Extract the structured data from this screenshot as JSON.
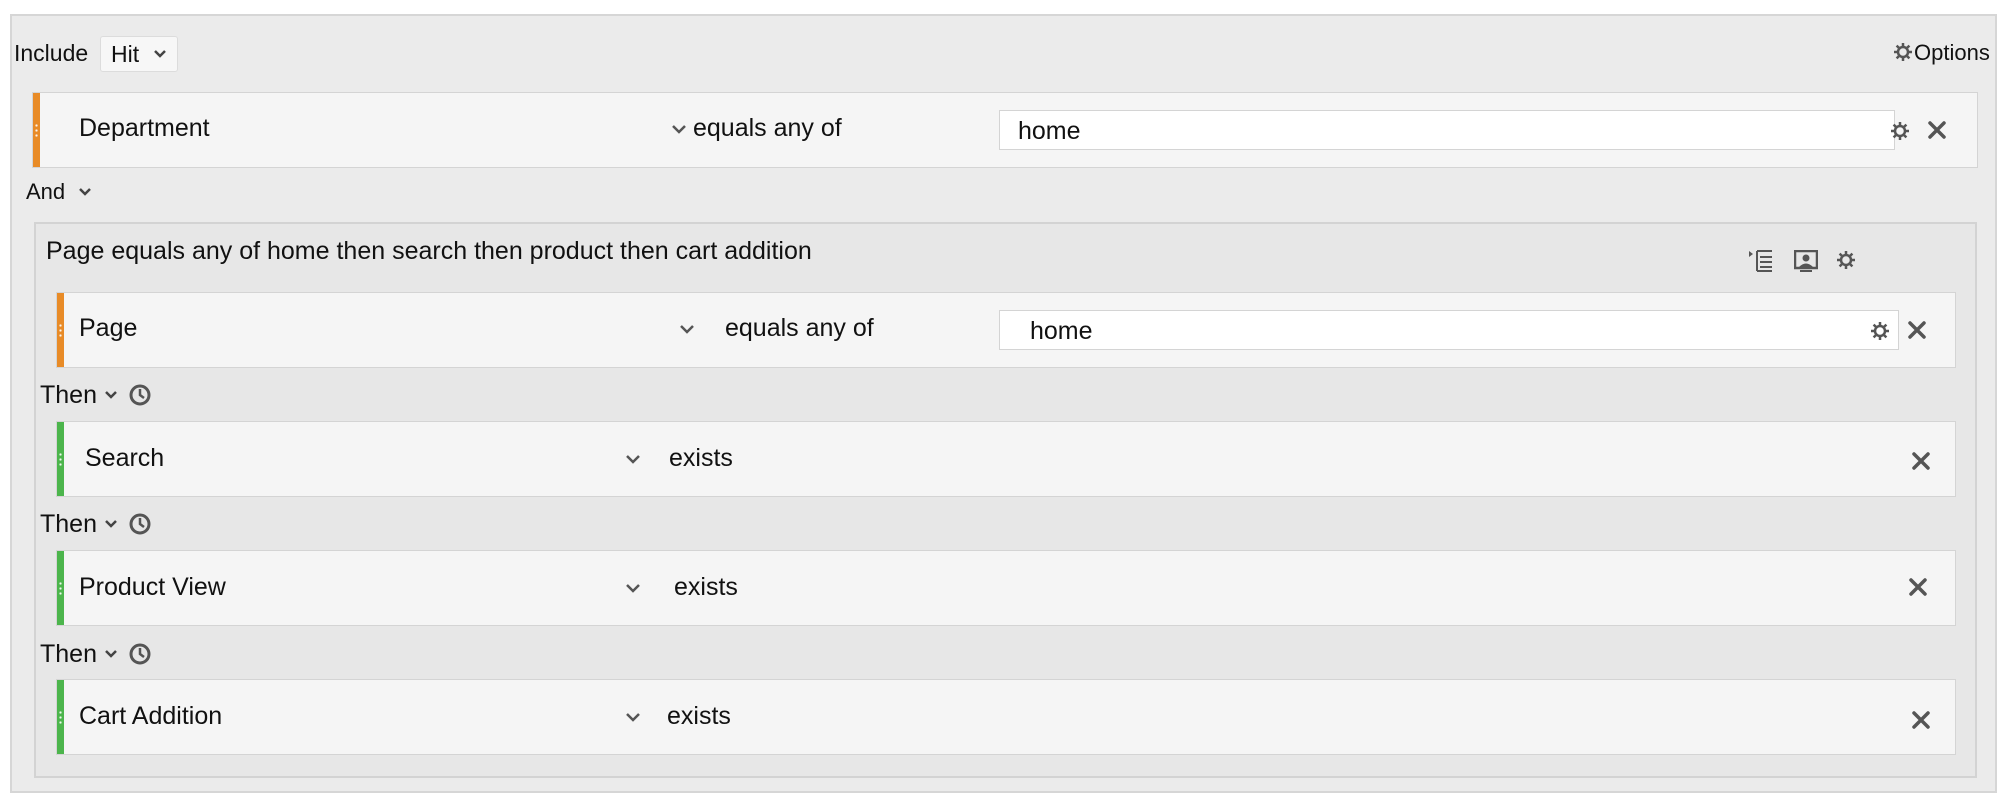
{
  "header": {
    "include_label": "Include",
    "scope_value": "Hit",
    "options_label": "Options"
  },
  "rule_department": {
    "dimension": "Department",
    "operator": "equals any of",
    "value": "home"
  },
  "connector": {
    "label": "And"
  },
  "sequence": {
    "title": "Page equals any of home then search then product then cart addition",
    "steps": [
      {
        "dimension": "Page",
        "operator": "equals any of",
        "value": "home",
        "color": "#e88b27"
      },
      {
        "then_label": "Then",
        "dimension": "Search",
        "operator": "exists",
        "color": "#4cb54c"
      },
      {
        "then_label": "Then",
        "dimension": "Product View",
        "operator": "exists",
        "color": "#4cb54c"
      },
      {
        "then_label": "Then",
        "dimension": "Cart Addition",
        "operator": "exists",
        "color": "#4cb54c"
      }
    ]
  },
  "colors": {
    "accent_orange": "#e88b27",
    "accent_green": "#4cb54c",
    "panel_bg": "#ebebeb"
  }
}
